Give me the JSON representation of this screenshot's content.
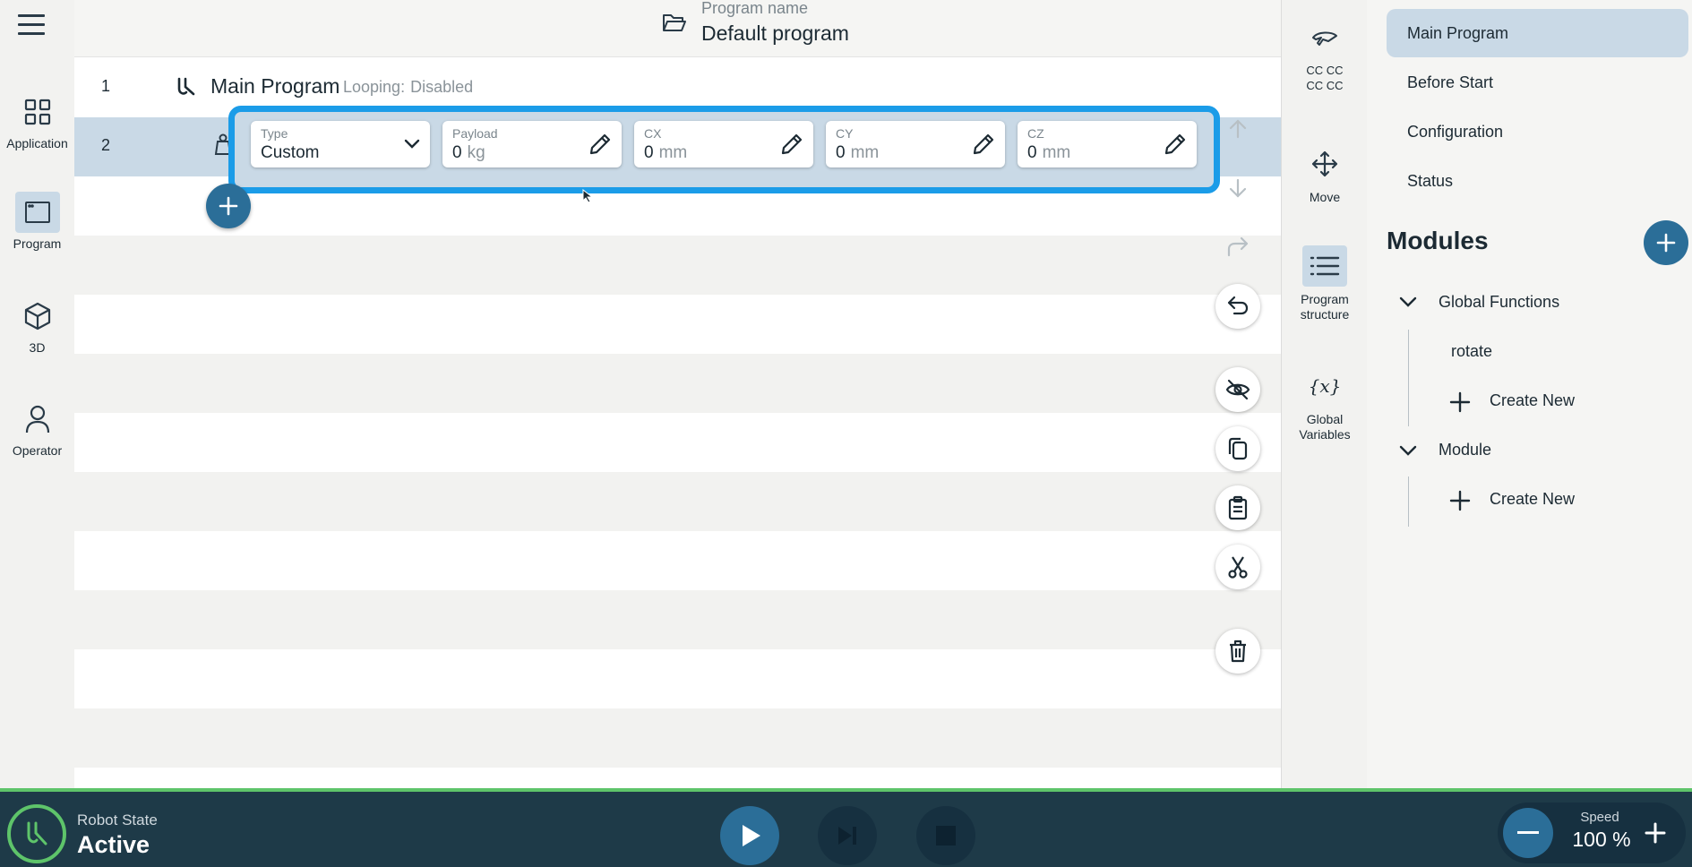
{
  "header": {
    "program_label": "Program name",
    "program_name": "Default program"
  },
  "leftnav": {
    "items": [
      {
        "label": "Application",
        "icon": "grid-icon"
      },
      {
        "label": "Program",
        "icon": "program-window-icon",
        "active": true
      },
      {
        "label": "3D",
        "icon": "cube-icon"
      },
      {
        "label": "Operator",
        "icon": "person-icon"
      }
    ]
  },
  "program": {
    "rows": [
      {
        "num": "1",
        "title": "Main Program",
        "looping_label": "Looping:",
        "looping_value": "Disabled"
      },
      {
        "num": "2"
      }
    ],
    "payload_editor": {
      "type": {
        "label": "Type",
        "value": "Custom"
      },
      "payload": {
        "label": "Payload",
        "value": "0",
        "unit": "kg"
      },
      "cx": {
        "label": "CX",
        "value": "0",
        "unit": "mm"
      },
      "cy": {
        "label": "CY",
        "value": "0",
        "unit": "mm"
      },
      "cz": {
        "label": "CZ",
        "value": "0",
        "unit": "mm"
      }
    }
  },
  "rail": {
    "items": [
      {
        "label": "CC CC\nCC CC",
        "icon": "tool-flange-icon"
      },
      {
        "label": "Move",
        "icon": "move-arrows-icon"
      },
      {
        "label": "Program\nstructure",
        "icon": "list-icon",
        "active": true
      },
      {
        "label": "Global\nVariables",
        "icon": "variable-x-icon"
      }
    ]
  },
  "rpanel": {
    "items": [
      {
        "label": "Main Program",
        "active": true
      },
      {
        "label": "Before Start"
      },
      {
        "label": "Configuration"
      },
      {
        "label": "Status"
      }
    ],
    "modules_title": "Modules",
    "groups": [
      {
        "name": "Global Functions",
        "children": [
          "rotate"
        ],
        "create": "Create New"
      },
      {
        "name": "Module",
        "children": [],
        "create": "Create New"
      }
    ]
  },
  "bottom": {
    "robot_state_label": "Robot State",
    "robot_state_value": "Active",
    "speed_label": "Speed",
    "speed_value": "100 %"
  },
  "colors": {
    "accent": "#2b6e98",
    "selection": "#c9d9e6",
    "highlight": "#1b9ce8",
    "status_green": "#5ec46a",
    "bar": "#1e3a48"
  }
}
